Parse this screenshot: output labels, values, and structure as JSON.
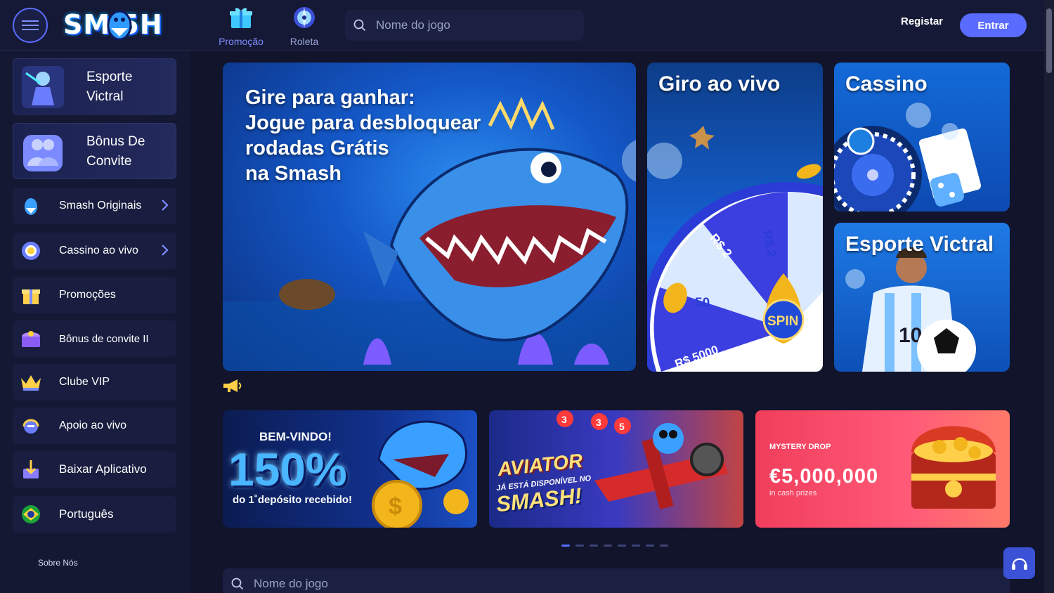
{
  "header": {
    "logo_text": "SM 5H",
    "nav": [
      {
        "label": "Promoção",
        "icon": "gift-icon"
      },
      {
        "label": "Roleta",
        "icon": "roulette-icon"
      }
    ],
    "search_placeholder": "Nome do jogo",
    "register_label": "Registar",
    "login_label": "Entrar"
  },
  "sidebar": {
    "cards": [
      {
        "label": "Esporte Victral",
        "icon": "sport-warrior-icon"
      },
      {
        "label": "Bônus De Convite",
        "icon": "users-icon"
      }
    ],
    "items": [
      {
        "label": "Smash Originais",
        "icon": "shark-icon",
        "has_chevron": true
      },
      {
        "label": "Cassino ao vivo",
        "icon": "casino-chip-icon",
        "has_chevron": true
      },
      {
        "label": "Promoções",
        "icon": "gift-icon",
        "has_chevron": false
      },
      {
        "label": "Bônus de convite II",
        "icon": "treasure-chest-icon",
        "has_chevron": false
      },
      {
        "label": "Clube VIP",
        "icon": "crown-icon",
        "has_chevron": false
      },
      {
        "label": "Apoio ao vivo",
        "icon": "headset-icon",
        "has_chevron": false
      },
      {
        "label": "Baixar Aplicativo",
        "icon": "download-icon",
        "has_chevron": false
      },
      {
        "label": "Português",
        "icon": "brazil-flag-icon",
        "has_chevron": false
      }
    ],
    "footer_link": "Sobre Nós"
  },
  "banners": {
    "main_title_lines": [
      "Gire para ganhar:",
      "Jogue para desbloquear",
      "rodadas Grátis",
      "na Smash"
    ],
    "giro_title": "Giro ao vivo",
    "wheel_labels": [
      "R$ 2",
      "R$ 2",
      "50",
      "R$ 5000"
    ],
    "spin_label": "SPIN",
    "cassino_title": "Cassino",
    "esporte_title": "Esporte Victral"
  },
  "promos": {
    "p1": {
      "top": "BEM-VINDO!",
      "big": "150%",
      "sub": "do 1˚depósito recebido!"
    },
    "p2": {
      "line1": "AVIATOR",
      "line2": "JÁ ESTÁ DISPONÍVEL NO",
      "line3": "SMASH!",
      "badges": [
        "3",
        "3",
        "5"
      ]
    },
    "p3": {
      "brand": "MYSTERY DROP",
      "amount": "€5,000,000",
      "sub": "in cash prizes"
    }
  },
  "carousel": {
    "count": 8,
    "active_index": 0
  },
  "bottom_search_placeholder": "Nome do jogo",
  "colors": {
    "accent": "#5a6cff",
    "bg": "#11142a",
    "panel": "#151935"
  }
}
